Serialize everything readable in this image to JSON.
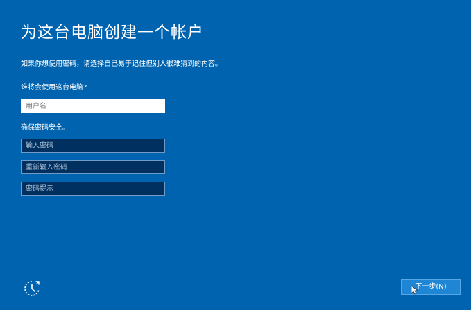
{
  "page": {
    "title": "为这台电脑创建一个帐户",
    "subtitle": "如果你想使用密码，请选择自己易于记住但别人很难猜到的内容。"
  },
  "who": {
    "label": "谁将会使用这台电脑?",
    "username_placeholder": "用户名"
  },
  "security": {
    "label": "确保密码安全。",
    "password_placeholder": "输入密码",
    "reenter_placeholder": "重新输入密码",
    "hint_placeholder": "密码提示"
  },
  "footer": {
    "next_label": "下一步(N)",
    "accessibility_icon": "ease-of-access-icon"
  },
  "colors": {
    "background": "#0063af",
    "button": "#1f86d6",
    "dark_field": "#00305f"
  }
}
